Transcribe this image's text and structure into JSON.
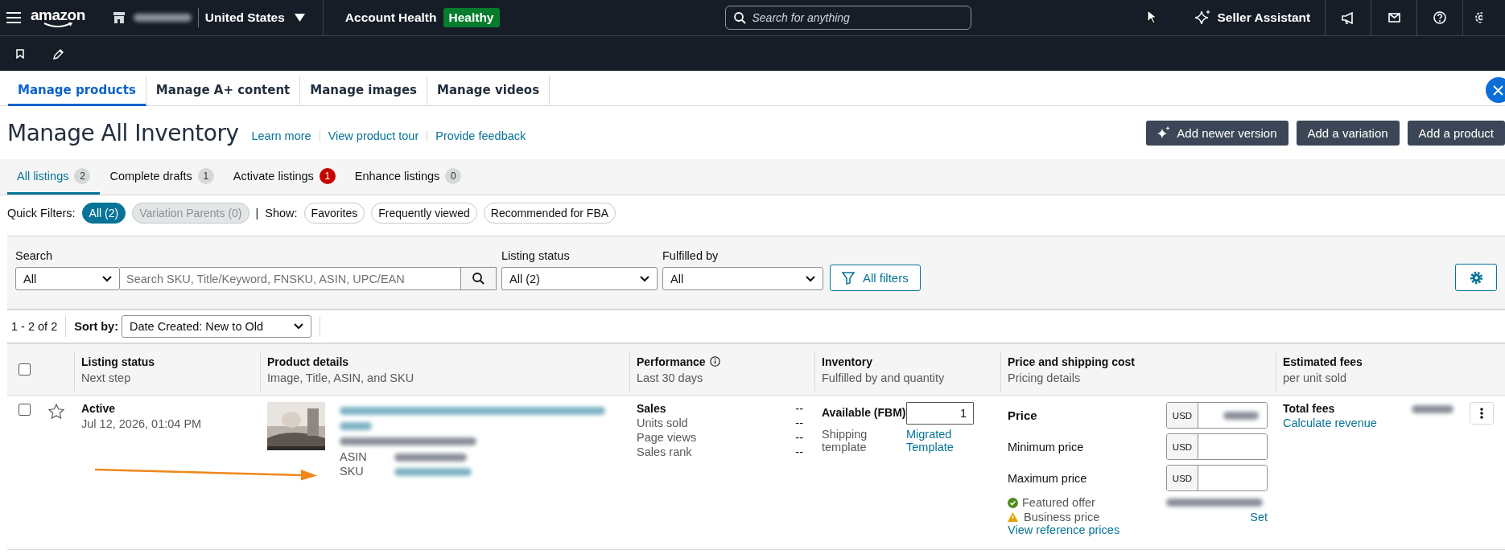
{
  "top_bar": {
    "logo": "amazon",
    "marketplace": "United States",
    "account_health": {
      "label": "Account Health",
      "status": "Healthy"
    },
    "search": {
      "placeholder": "Search for anything"
    },
    "seller_assistant": "Seller Assistant"
  },
  "page_tabs": [
    {
      "label": "Manage products",
      "selected": true
    },
    {
      "label": "Manage A+ content",
      "selected": false
    },
    {
      "label": "Manage images",
      "selected": false
    },
    {
      "label": "Manage videos",
      "selected": false
    }
  ],
  "title": "Manage All Inventory",
  "links": [
    "Learn more",
    "View product tour",
    "Provide feedback"
  ],
  "actions": [
    {
      "label": "Add newer version",
      "kind": "sparkle"
    },
    {
      "label": "Add a variation",
      "kind": "plain"
    },
    {
      "label": "Add a product",
      "kind": "plain"
    }
  ],
  "listing_tabs": [
    {
      "label": "All listings",
      "count": "2",
      "selected": true,
      "alert": false
    },
    {
      "label": "Complete drafts",
      "count": "1",
      "selected": false,
      "alert": false
    },
    {
      "label": "Activate listings",
      "count": "1",
      "selected": false,
      "alert": true
    },
    {
      "label": "Enhance listings",
      "count": "0",
      "selected": false,
      "alert": false
    }
  ],
  "quick_filters": {
    "label": "Quick Filters:",
    "chips": [
      {
        "label": "All (2)",
        "selected": true,
        "disabled": false
      },
      {
        "label": "Variation Parents (0)",
        "selected": false,
        "disabled": true
      }
    ],
    "separator": "|",
    "show_label": "Show:",
    "show_chips": [
      "Favorites",
      "Frequently viewed",
      "Recommended for FBA"
    ]
  },
  "filters": {
    "search_label": "Search",
    "scope": "All",
    "search_placeholder": "Search SKU, Title/Keyword, FNSKU, ASIN, UPC/EAN",
    "status_label": "Listing status",
    "status_value": "All (2)",
    "fulfilled_label": "Fulfilled by",
    "fulfilled_value": "All",
    "all_filters": "All filters"
  },
  "results": {
    "count": "1 - 2 of 2",
    "sort_label": "Sort by:",
    "sort_value": "Date Created: New to Old"
  },
  "table": {
    "all_checked": false,
    "columns": [
      {
        "title": "Listing status",
        "subtitle": "Next step",
        "info": false
      },
      {
        "title": "Product details",
        "subtitle": "Image, Title, ASIN, and SKU",
        "info": false
      },
      {
        "title": "Performance",
        "subtitle": "Last 30 days",
        "info": true
      },
      {
        "title": "Inventory",
        "subtitle": "Fulfilled by and quantity",
        "info": false
      },
      {
        "title": "Price and shipping cost",
        "subtitle": "Pricing details",
        "info": false
      },
      {
        "title": "Estimated fees",
        "subtitle": "per unit sold",
        "info": false
      }
    ],
    "rows": [
      {
        "checked": false,
        "favorite": false,
        "status": "Active",
        "date": "Jul 12, 2026, 01:04 PM",
        "asin_label": "ASIN",
        "sku_label": "SKU",
        "performance": [
          {
            "label": "Sales",
            "value": "--"
          },
          {
            "label": "Units sold",
            "value": "--"
          },
          {
            "label": "Page views",
            "value": "--"
          },
          {
            "label": "Sales rank",
            "value": "--"
          }
        ],
        "inventory": {
          "label": "Available (FBM)",
          "quantity": "1",
          "shipping_label": "Shipping template",
          "shipping_value": "Migrated Template"
        },
        "pricing": [
          {
            "label": "Price",
            "currency": "USD",
            "kind": "main"
          },
          {
            "label": "Minimum price",
            "currency": "USD",
            "kind": "range"
          },
          {
            "label": "Maximum price",
            "currency": "USD",
            "kind": "range"
          }
        ],
        "featured": "Featured offer",
        "business": "Business price",
        "business_action": "Set",
        "reference": "View reference prices",
        "fees_label": "Total fees",
        "fees_link": "Calculate revenue"
      }
    ]
  }
}
